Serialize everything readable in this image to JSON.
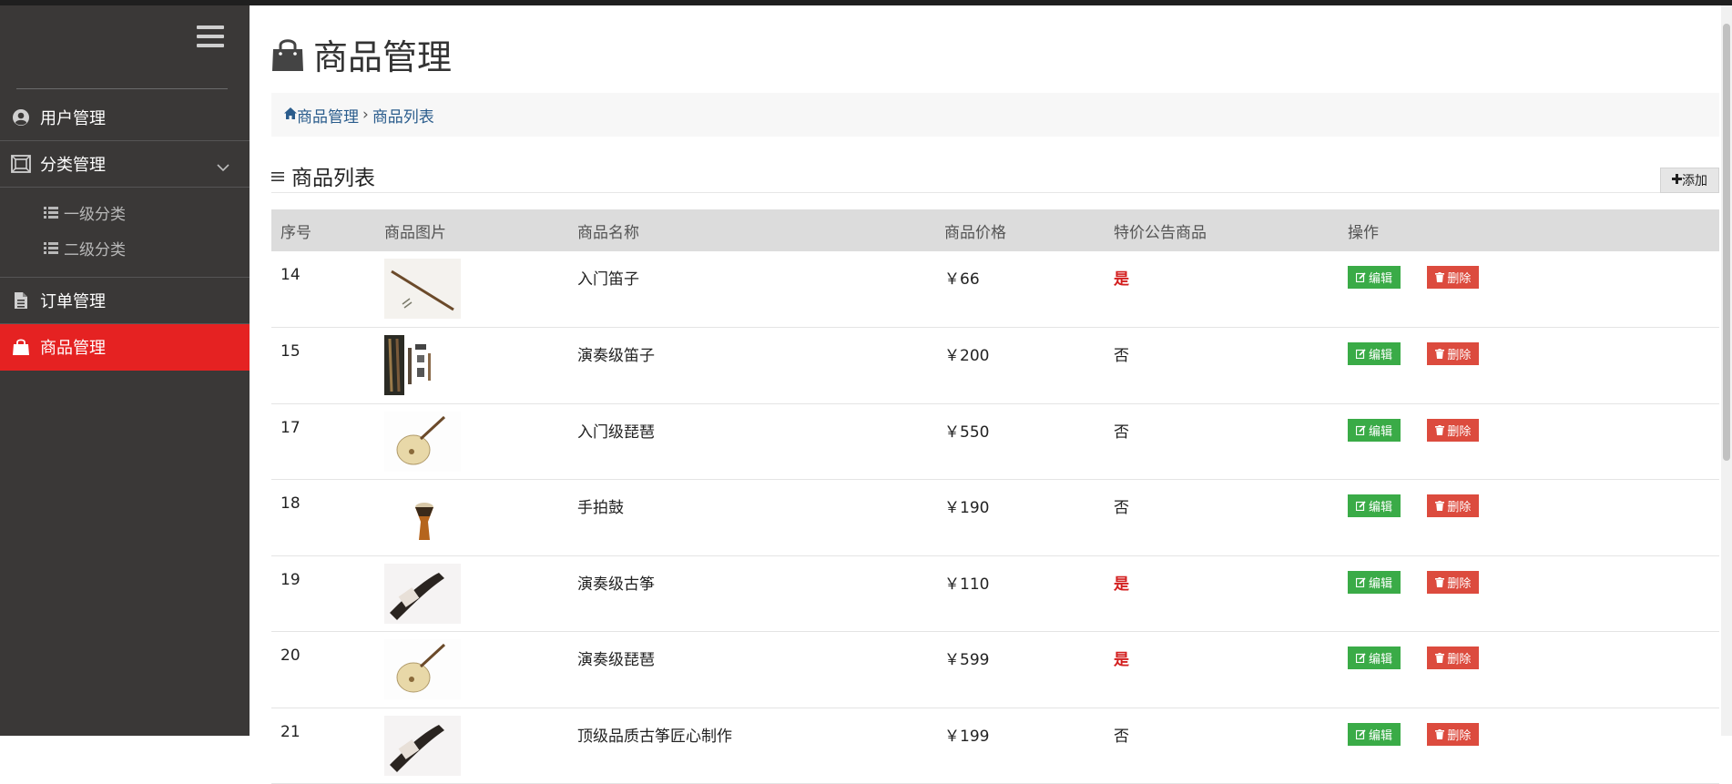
{
  "sidebar": {
    "items": [
      {
        "label": "用户管理",
        "icon": "user-circle-icon"
      },
      {
        "label": "分类管理",
        "icon": "category-icon"
      },
      {
        "label": "订单管理",
        "icon": "document-icon"
      },
      {
        "label": "商品管理",
        "icon": "shopping-bag-icon"
      }
    ],
    "sub_items": [
      {
        "label": "一级分类",
        "icon": "list-icon"
      },
      {
        "label": "二级分类",
        "icon": "list-icon"
      }
    ],
    "active_color": "#e52222"
  },
  "page": {
    "title": "商品管理",
    "breadcrumb": {
      "home": "商品管理",
      "current": "商品列表"
    },
    "section_title": "商品列表",
    "add_label": "添加"
  },
  "table": {
    "headers": [
      "序号",
      "商品图片",
      "商品名称",
      "商品价格",
      "特价公告商品",
      "操作"
    ],
    "edit_label": "编辑",
    "delete_label": "删除",
    "rows": [
      {
        "id": "14",
        "name": "入门笛子",
        "price": "￥66",
        "special": "是",
        "image": "flute-image"
      },
      {
        "id": "15",
        "name": "演奏级笛子",
        "price": "￥200",
        "special": "否",
        "image": "flute-set-image"
      },
      {
        "id": "17",
        "name": "入门级琵琶",
        "price": "￥550",
        "special": "否",
        "image": "pipa-image"
      },
      {
        "id": "18",
        "name": "手拍鼓",
        "price": "￥190",
        "special": "否",
        "image": "hand-drum-image"
      },
      {
        "id": "19",
        "name": "演奏级古筝",
        "price": "￥110",
        "special": "是",
        "image": "guzheng-image"
      },
      {
        "id": "20",
        "name": "演奏级琵琶",
        "price": "￥599",
        "special": "是",
        "image": "pipa-image"
      },
      {
        "id": "21",
        "name": "顶级品质古筝匠心制作",
        "price": "￥199",
        "special": "否",
        "image": "guzheng-image"
      }
    ]
  },
  "colors": {
    "edit": "#3aab47",
    "delete": "#dc4b3e",
    "special_yes": "#d32020"
  }
}
